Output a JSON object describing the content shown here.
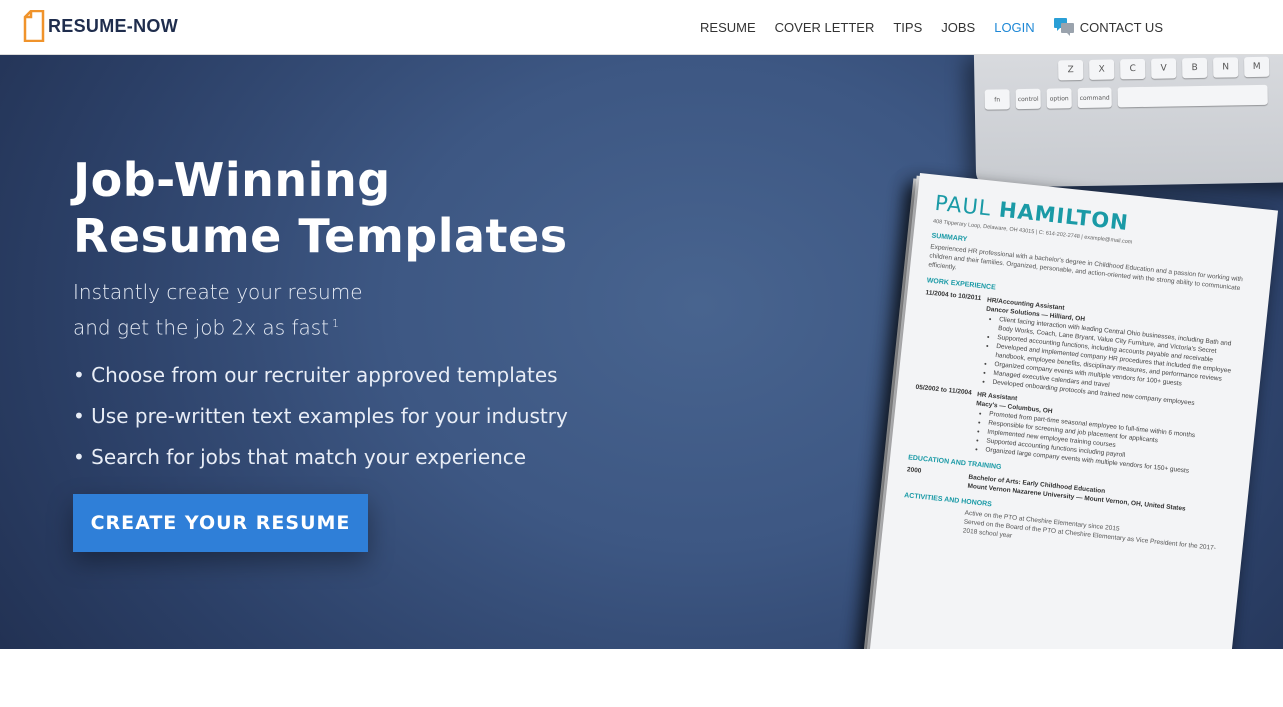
{
  "header": {
    "logo_text": "RESUME-NOW",
    "nav": [
      {
        "label": "RESUME"
      },
      {
        "label": "COVER LETTER"
      },
      {
        "label": "TIPS"
      },
      {
        "label": "JOBS"
      },
      {
        "label": "LOGIN"
      },
      {
        "label": "CONTACT US",
        "icon": "chat-icon"
      }
    ],
    "colors": {
      "logo_orange": "#f0932b",
      "logo_navy": "#1f2d4d",
      "login_blue": "#1e88d6"
    }
  },
  "hero": {
    "headline_line1": "Job-Winning",
    "headline_line2": "Resume Templates",
    "sub_line1": "Instantly create your resume",
    "sub_line2": "and get the job 2x as fast",
    "sub_footnote": "1",
    "bullets": [
      "Choose from our recruiter approved templates",
      "Use pre-written text examples for your industry",
      "Search for jobs that match your experience"
    ],
    "cta_label": "CREATE YOUR RESUME",
    "colors": {
      "cta": "#2f7fd8",
      "bg_dark": "#1f2d4d",
      "bg_light": "#48648f"
    }
  },
  "keyboard": {
    "row1": [
      "Z",
      "X",
      "C",
      "V",
      "B",
      "N",
      "M"
    ],
    "row2": [
      "fn",
      "control",
      "option",
      "command"
    ]
  },
  "resume_preview": {
    "first_name": "PAUL",
    "last_name": "HAMILTON",
    "contact": "408 Tipperary Loop, Delaware, OH 43015 | C: 614-202-2748 | example@mail.com",
    "summary_heading": "SUMMARY",
    "summary_text": "Experienced HR professional with a bachelor's degree in Childhood Education and a passion for working with children and their families. Organized, personable, and action-oriented with the strong ability to communicate efficiently.",
    "work_heading": "WORK EXPERIENCE",
    "jobs": [
      {
        "dates": "11/2004 to 10/2011",
        "title": "HR/Accounting Assistant",
        "company": "Dancor Solutions — Hilliard, OH",
        "bullets": [
          "Client facing interaction with leading Central Ohio businesses, including Bath and Body Works, Coach, Lane Bryant, Value City Furniture, and Victoria's Secret",
          "Supported accounting functions, including accounts payable and receivable",
          "Developed and implemented company HR procedures that included the employee handbook, employee benefits, disciplinary measures, and performance reviews",
          "Organized company events with multiple vendors for 100+ guests",
          "Managed executive calendars and travel",
          "Developed onboarding protocols and trained new company employees"
        ]
      },
      {
        "dates": "05/2002 to 11/2004",
        "title": "HR Assistant",
        "company": "Macy's — Columbus, OH",
        "bullets": [
          "Promoted from part-time seasonal employee to full-time within 6 months",
          "Responsible for screening and job placement for applicants",
          "Implemented new employee training courses",
          "Supported accounting functions including payroll",
          "Organized large company events with multiple vendors for 150+ guests"
        ]
      }
    ],
    "education_heading": "EDUCATION AND TRAINING",
    "edu_year": "2000",
    "edu_degree": "Bachelor of Arts: Early Childhood Education",
    "edu_school": "Mount Vernon Nazarene University — Mount Vernon, OH, United States",
    "activities_heading": "ACTIVITIES AND HONORS",
    "activities": [
      "Active on the PTO at Cheshire Elementary since 2015",
      "Served on the Board of the PTO at Cheshire Elementary as Vice President for the 2017-2018 school year"
    ]
  }
}
